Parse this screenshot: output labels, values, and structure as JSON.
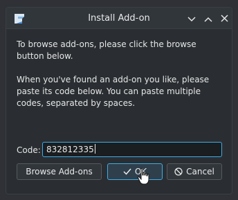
{
  "window": {
    "title": "Install Add-on"
  },
  "titlebar": {
    "app_icon": "app-icon",
    "buttons": [
      "chevron-down-icon",
      "chevron-up-icon",
      "close-icon"
    ]
  },
  "message": {
    "paragraph1": "To browse add-ons, please click the browse button below.",
    "paragraph2": "When you've found an add-on you like, please paste its code below. You can paste multiple codes, separated by spaces."
  },
  "code": {
    "label": "Code:",
    "value": "832812335"
  },
  "buttons": {
    "browse": "Browse Add-ons",
    "ok": "OK",
    "cancel": "Cancel"
  },
  "colors": {
    "accent": "#3daee9",
    "window_bg": "#2a2e32",
    "text": "#e6e6e6"
  }
}
